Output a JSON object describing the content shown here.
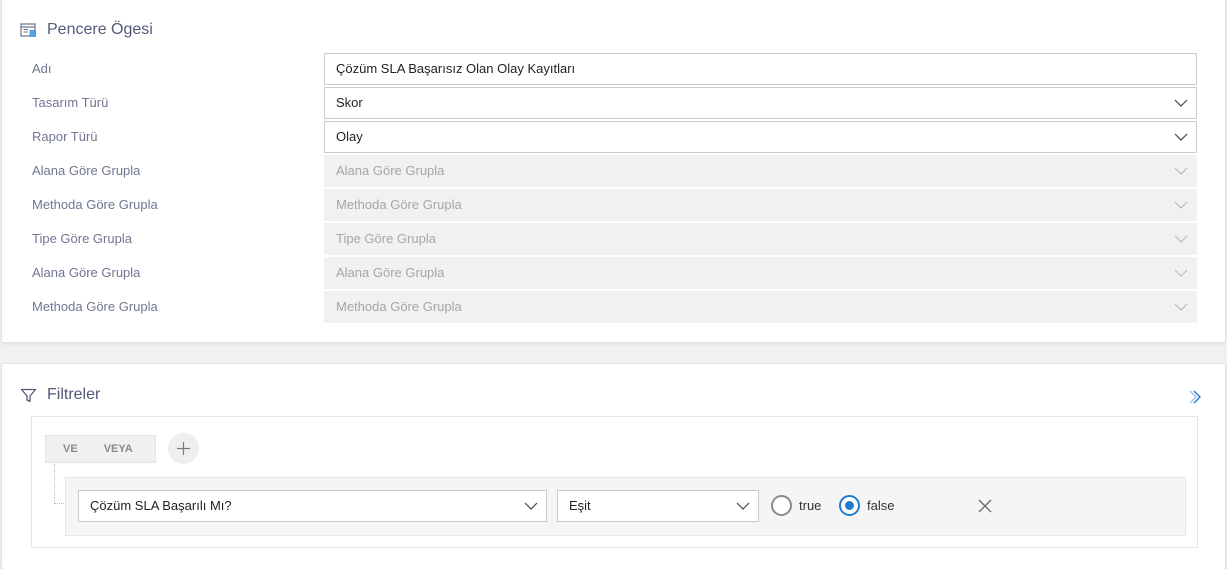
{
  "window_item": {
    "title": "Pencere Ögesi",
    "fields": [
      {
        "label": "Adı",
        "value": "Çözüm SLA Başarısız Olan Olay Kayıtları",
        "type": "text",
        "disabled": false
      },
      {
        "label": "Tasarım Türü",
        "value": "Skor",
        "type": "select",
        "disabled": false
      },
      {
        "label": "Rapor Türü",
        "value": "Olay",
        "type": "select",
        "disabled": false
      },
      {
        "label": "Alana Göre Grupla",
        "value": "Alana Göre Grupla",
        "type": "select",
        "disabled": true
      },
      {
        "label": "Methoda Göre Grupla",
        "value": "Methoda Göre Grupla",
        "type": "select",
        "disabled": true
      },
      {
        "label": "Tipe Göre Grupla",
        "value": "Tipe Göre Grupla",
        "type": "select",
        "disabled": true
      },
      {
        "label": "Alana Göre Grupla",
        "value": "Alana Göre Grupla",
        "type": "select",
        "disabled": true
      },
      {
        "label": "Methoda Göre Grupla",
        "value": "Methoda Göre Grupla",
        "type": "select",
        "disabled": true
      }
    ]
  },
  "filters": {
    "title": "Filtreler",
    "logic": {
      "and_label": "VE",
      "or_label": "VEYA"
    },
    "rule": {
      "field": "Çözüm SLA Başarılı Mı?",
      "operator": "Eşit",
      "option_true": "true",
      "option_false": "false",
      "selected": "false"
    }
  },
  "colors": {
    "accent": "#1f7ad1",
    "title": "#54597a",
    "label": "#707692"
  }
}
